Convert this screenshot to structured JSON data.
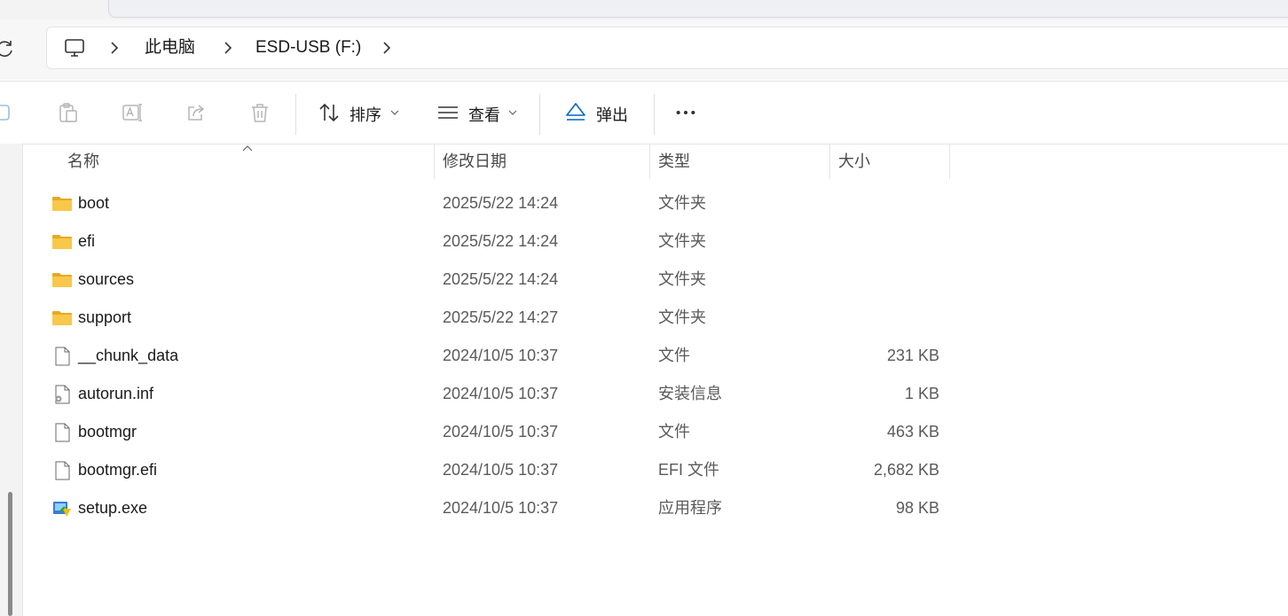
{
  "breadcrumb": {
    "items": [
      "此电脑",
      "ESD-USB (F:)"
    ]
  },
  "toolbar": {
    "sort_label": "排序",
    "view_label": "查看",
    "eject_label": "弹出"
  },
  "columns": {
    "name": "名称",
    "date": "修改日期",
    "type": "类型",
    "size": "大小"
  },
  "files": [
    {
      "name": "boot",
      "date": "2025/5/22 14:24",
      "type": "文件夹",
      "size": "",
      "icon": "folder-icon"
    },
    {
      "name": "efi",
      "date": "2025/5/22 14:24",
      "type": "文件夹",
      "size": "",
      "icon": "folder-icon"
    },
    {
      "name": "sources",
      "date": "2025/5/22 14:24",
      "type": "文件夹",
      "size": "",
      "icon": "folder-icon"
    },
    {
      "name": "support",
      "date": "2025/5/22 14:27",
      "type": "文件夹",
      "size": "",
      "icon": "folder-icon"
    },
    {
      "name": "__chunk_data",
      "date": "2024/10/5 10:37",
      "type": "文件",
      "size": "231 KB",
      "icon": "file-icon"
    },
    {
      "name": "autorun.inf",
      "date": "2024/10/5 10:37",
      "type": "安装信息",
      "size": "1 KB",
      "icon": "settings-file-icon"
    },
    {
      "name": "bootmgr",
      "date": "2024/10/5 10:37",
      "type": "文件",
      "size": "463 KB",
      "icon": "file-icon"
    },
    {
      "name": "bootmgr.efi",
      "date": "2024/10/5 10:37",
      "type": "EFI 文件",
      "size": "2,682 KB",
      "icon": "file-icon"
    },
    {
      "name": "setup.exe",
      "date": "2024/10/5 10:37",
      "type": "应用程序",
      "size": "98 KB",
      "icon": "setup-exe-icon"
    }
  ],
  "colors": {
    "accent": "#0067c0",
    "folder": "#f8c84a"
  }
}
